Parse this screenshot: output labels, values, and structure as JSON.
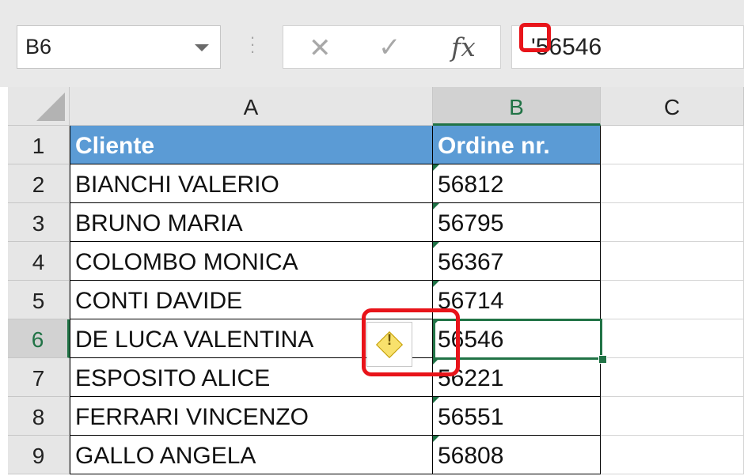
{
  "formula_bar": {
    "name_box": "B6",
    "cancel_icon": "✕",
    "enter_icon": "✓",
    "fx_label": "fx",
    "formula_value": "'56546"
  },
  "columns": [
    "A",
    "B",
    "C"
  ],
  "rows": [
    {
      "num": "1",
      "a": "Cliente",
      "b": "Ordine nr."
    },
    {
      "num": "2",
      "a": "BIANCHI VALERIO",
      "b": "56812"
    },
    {
      "num": "3",
      "a": "BRUNO MARIA",
      "b": "56795"
    },
    {
      "num": "4",
      "a": "COLOMBO MONICA",
      "b": "56367"
    },
    {
      "num": "5",
      "a": "CONTI DAVIDE",
      "b": "56714"
    },
    {
      "num": "6",
      "a": "DE LUCA VALENTINA",
      "b": "56546"
    },
    {
      "num": "7",
      "a": "ESPOSITO ALICE",
      "b": "56221"
    },
    {
      "num": "8",
      "a": "FERRARI VINCENZO",
      "b": "56551"
    },
    {
      "num": "9",
      "a": "GALLO ANGELA",
      "b": "56808"
    }
  ],
  "warning_icon": "!",
  "colors": {
    "header_fill": "#5b9bd5",
    "selection": "#217346",
    "highlight": "#e8141a"
  }
}
